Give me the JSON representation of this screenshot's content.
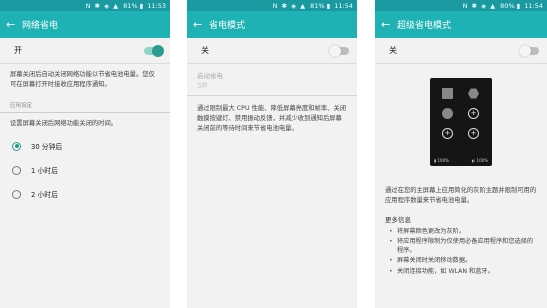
{
  "screen1": {
    "status_time": "11:53",
    "status_icons": "N ✱ ◈ ▲",
    "status_battery": "81% ▮",
    "title": "网络省电",
    "switch_label": "开",
    "switch_state": "on",
    "description": "屏幕关闭后自动关闭网络功能以节省电池电量。您仅可在屏幕打开时接收应用程序通知。",
    "section_header": "应用设定",
    "prompt": "设置屏幕关闭后网络功能关闭的时间。",
    "options": [
      "30 分钟后",
      "1 小时后",
      "2 小时后"
    ],
    "selected_option": "30 分钟后"
  },
  "screen2": {
    "status_time": "11:54",
    "status_icons": "N ✱ ◈ ▲",
    "status_battery": "81% ▮",
    "title": "省电模式",
    "switch_label": "关",
    "switch_state": "off",
    "sub_title": "启动省电",
    "sub_value": "立即",
    "description": "通过限制最大 CPU 性能、降低屏幕亮度和帧率、关闭触摸按键灯、禁用振动反馈，并减少收到通知后屏幕关闭前的等待时间来节省电池电量。"
  },
  "screen3": {
    "status_time": "11:54",
    "status_icons": "N ✱ ◈ ▲",
    "status_battery": "80% ▮",
    "title": "超级省电模式",
    "switch_label": "关",
    "switch_state": "off",
    "preview_left": "▮ 100%",
    "preview_right": "◐ 100%",
    "description": "通过在您的主屏幕上应用简化的灰阶主题并限制可用的应用程序数量来节省电池电量。",
    "more_info_title": "更多信息",
    "bullets": [
      "将屏幕颜色更改为灰阶。",
      "将应用程序限制为仅使用必备应用程序和您选择的程序。",
      "屏幕关闭时关闭移动数据。",
      "关闭连接功能，如 WLAN 和蓝牙。"
    ]
  },
  "colors": {
    "appbar": "#1eb2b4",
    "statusbar": "#1a9aa0",
    "accent": "#2a9d8f",
    "background": "#f2f2f2"
  }
}
